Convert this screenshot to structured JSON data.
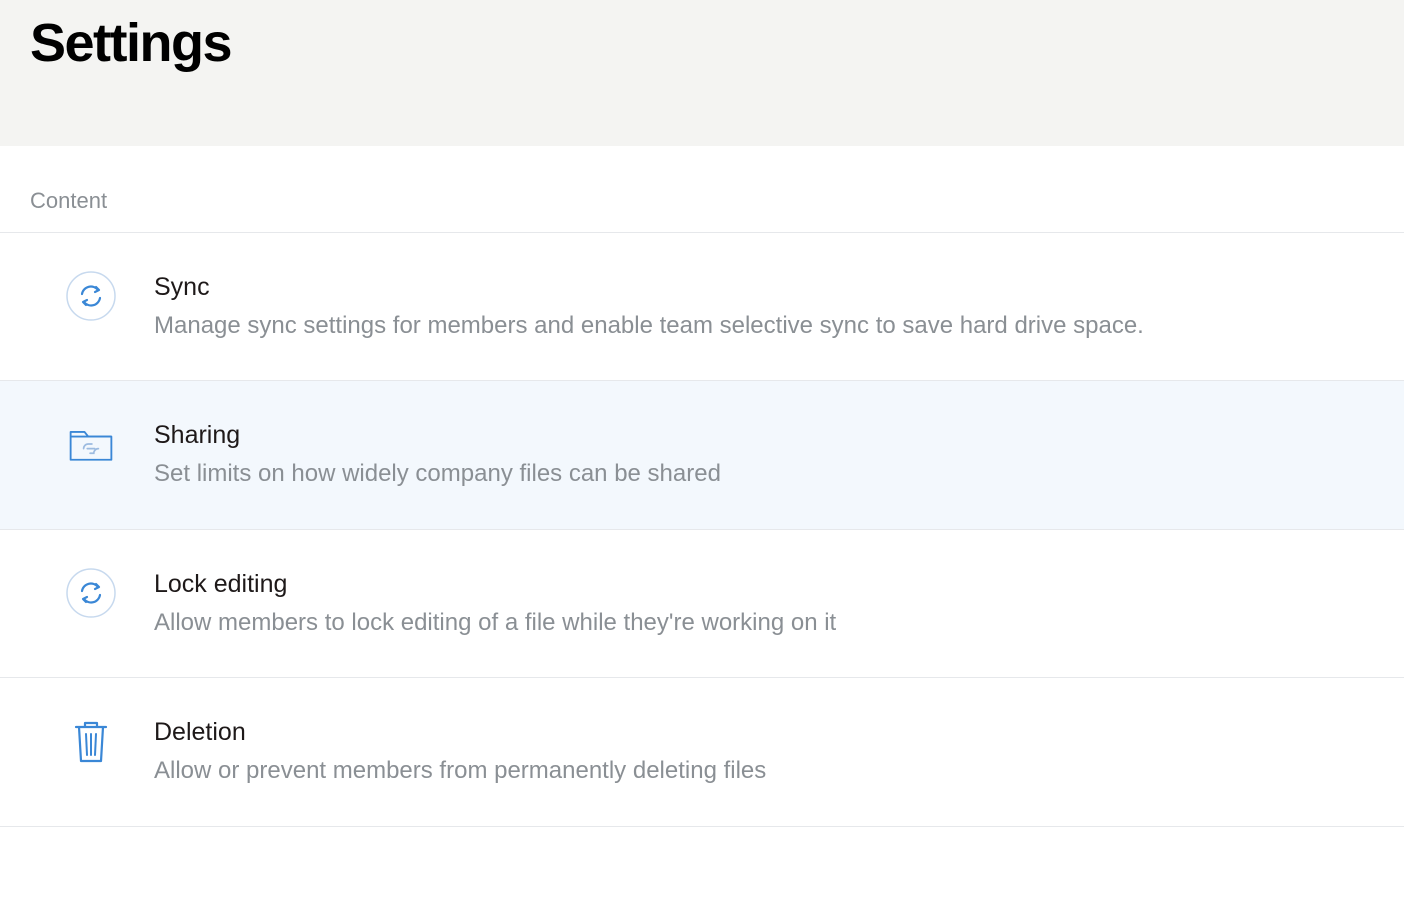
{
  "page": {
    "title": "Settings"
  },
  "section": {
    "label": "Content",
    "items": [
      {
        "icon": "sync-icon",
        "title": "Sync",
        "desc": "Manage sync settings for members and enable team selective sync to save hard drive space."
      },
      {
        "icon": "folder-link-icon",
        "title": "Sharing",
        "desc": "Set limits on how widely company files can be shared"
      },
      {
        "icon": "sync-icon",
        "title": "Lock editing",
        "desc": "Allow members to lock editing of a file while they're working on it"
      },
      {
        "icon": "trash-icon",
        "title": "Deletion",
        "desc": "Allow or prevent members from permanently deleting files"
      }
    ]
  }
}
